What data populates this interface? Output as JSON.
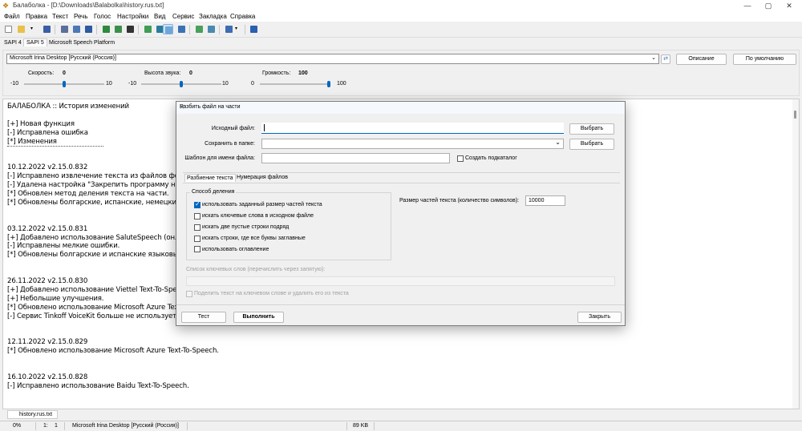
{
  "window": {
    "title": "Балаболка - [D:\\Downloads\\Balabolka\\history.rus.txt]"
  },
  "menu": [
    "Файл",
    "Правка",
    "Текст",
    "Речь",
    "Голос",
    "Настройки",
    "Вид",
    "Сервис",
    "Закладка",
    "Справка"
  ],
  "sapi_tabs": [
    "SAPI 4",
    "SAPI 5",
    "Microsoft Speech Platform"
  ],
  "voice": {
    "selected": "Microsoft Irina Desktop [Русский (Россия)]",
    "describe_label": "Описание",
    "default_label": "По умолчанию",
    "rate_label": "Скорость:",
    "rate_value": "0",
    "rate_min": "-10",
    "rate_max": "10",
    "pitch_label": "Высота звука:",
    "pitch_value": "0",
    "pitch_min": "-10",
    "pitch_max": "10",
    "volume_label": "Громкость:",
    "volume_value": "100",
    "volume_min": "0",
    "volume_max": "100",
    "rate_pos": 0.5,
    "pitch_pos": 0.5,
    "volume_pos": 1.0
  },
  "editor": {
    "lines": [
      "БАЛАБОЛКА :: История изменений",
      "",
      "[+] Новая функция",
      "[-] Исправлена ошибка",
      "[*] Изменения",
      "",
      "",
      "10.12.2022    v2.15.0.832",
      "[-] Исправлено извлечение текста из файлов форм",
      "[-] Удалена настройка \"Закрепить программу на па",
      "[*] Обновлен метод деления текста на части.",
      "[*] Обновлены болгарские, испанские, немецкие, сл",
      "",
      "",
      "03.12.2022    v2.15.0.831",
      "[+] Добавлено использование SaluteSpeech (онлайн",
      "[-] Исправлены мелкие ошибки.",
      "[*] Обновлены болгарские и испанские языковые ре",
      "",
      "",
      "26.11.2022    v2.15.0.830",
      "[+] Добавлено использование Viettel Text-To-Speech",
      "[+] Небольшие улучшения.",
      "[*] Обновлено использование Microsoft Azure Text-To",
      "[-] Сервис Tinkoff VoiceKit больше не используется. Г",
      "",
      "",
      "12.11.2022    v2.15.0.829",
      "[*] Обновлено использование Microsoft Azure Text-To-Speech.",
      "",
      "",
      "16.10.2022    v2.15.0.828",
      "[-] Исправлено использование Baidu Text-To-Speech."
    ]
  },
  "doc_tab": "history.rus.txt",
  "status": {
    "progress": "0%",
    "line": "1:",
    "col": "1",
    "voice": "Microsoft Irina Desktop [Русский (Россия)]",
    "size": "89 KB"
  },
  "dialog": {
    "title": "Разбить файл на части",
    "source_label": "Исходный файл:",
    "source_value": "",
    "save_label": "Сохранить в папке:",
    "save_value": "",
    "template_label": "Шаблон для имени файла:",
    "template_value": "",
    "browse1": "Выбрать",
    "browse2": "Выбрать",
    "subfolder_label": "Создать подкаталог",
    "tabs": [
      "Разбиение текста",
      "Нумерация файлов"
    ],
    "method_group": "Способ деления",
    "methods": [
      {
        "label": "использовать заданный размер частей текста",
        "checked": true
      },
      {
        "label": "искать ключевые слова в исходном файле",
        "checked": false
      },
      {
        "label": "искать две пустые строки подряд",
        "checked": false
      },
      {
        "label": "искать строки, где все буквы заглавные",
        "checked": false
      },
      {
        "label": "использовать оглавление",
        "checked": false
      }
    ],
    "size_label": "Размер частей текста (количество символов):",
    "size_value": "10000",
    "keywords_label": "Список ключевых слов (перечислить через запятую):",
    "split_delete_label": "Поделить текст на ключевом слове и удалить его из текста",
    "test_label": "Тест",
    "run_label": "Выполнить",
    "close_label": "Закрыть"
  }
}
